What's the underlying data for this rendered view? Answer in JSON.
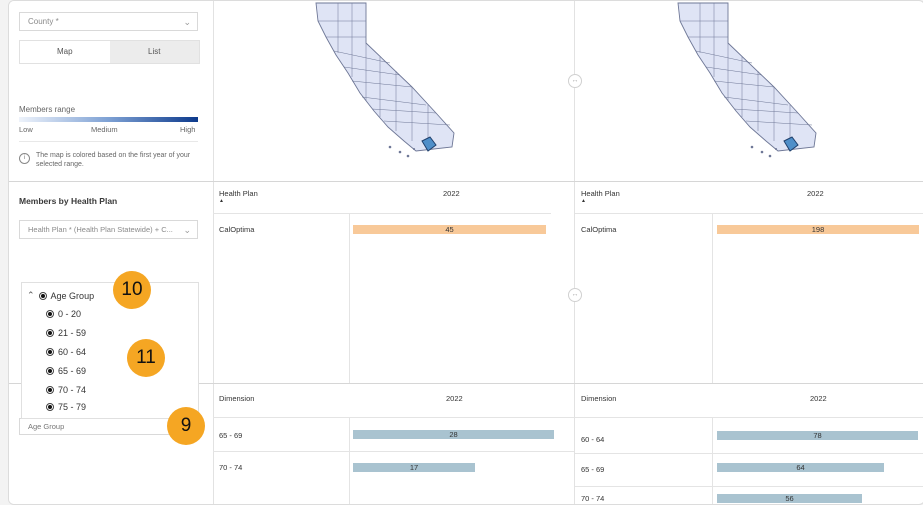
{
  "filters": {
    "county_placeholder": "County *",
    "map_toggle": "Map",
    "list_toggle": "List",
    "members_range_label": "Members range",
    "range_low": "Low",
    "range_medium": "Medium",
    "range_high": "High",
    "map_note": "The map is colored based on the first year of your selected range."
  },
  "health_plan_section": {
    "title": "Members by Health Plan",
    "dropdown_value": "Health Plan * (Health Plan Statewide) + C..."
  },
  "age_group_tree": {
    "root_label": "Age Group",
    "items": [
      "0 - 20",
      "21 - 59",
      "60 - 64",
      "65 - 69",
      "70 - 74",
      "75 - 79"
    ],
    "field_label": "Age Group"
  },
  "badges": {
    "b10": "10",
    "b11": "11",
    "b9": "9"
  },
  "left_plan_table": {
    "col1": "Health Plan",
    "col2": "2022",
    "rows": [
      {
        "name": "CalOptima",
        "value": "45",
        "fraction": 0.34
      }
    ]
  },
  "right_plan_table": {
    "col1": "Health Plan",
    "col2": "2022",
    "rows": [
      {
        "name": "CalOptima",
        "value": "198",
        "fraction": 1.0
      }
    ]
  },
  "left_dim_table": {
    "col1": "Dimension",
    "col2": "2022",
    "rows": [
      {
        "name": "65 - 69",
        "value": "28",
        "fraction": 1.0
      },
      {
        "name": "70 - 74",
        "value": "17",
        "fraction": 0.61
      }
    ]
  },
  "right_dim_table": {
    "col1": "Dimension",
    "col2": "2022",
    "rows": [
      {
        "name": "60 - 64",
        "value": "78",
        "fraction": 1.0
      },
      {
        "name": "65 - 69",
        "value": "64",
        "fraction": 0.82
      },
      {
        "name": "70 - 74",
        "value": "56",
        "fraction": 0.72
      }
    ]
  },
  "colors": {
    "map_fill": "#dfe4f5",
    "map_stroke": "#6e7796",
    "highlight": "#4f8fc9"
  }
}
